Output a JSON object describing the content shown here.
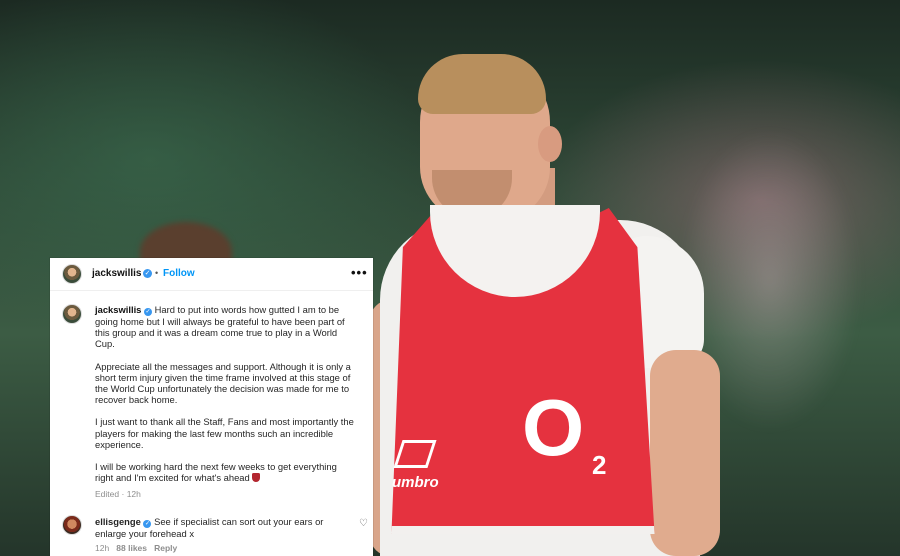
{
  "post": {
    "author": "jackswillis",
    "follow_label": "Follow",
    "separator": "•",
    "more_label": "•••",
    "caption_paragraphs": [
      "Hard to put into words how gutted I am to be going home but I will always be grateful to have been part of this group and it was a dream come true to play in a World Cup.",
      "Appreciate all the messages and support. Although it is only a short term injury given the time frame involved at this stage of the World Cup unfortunately the decision was made for me to recover back home.",
      "I just want to thank all the Staff, Fans and most importantly the players for making the last few months such an incredible experience.",
      "I will be working hard the next few weeks to get everything right and I'm excited for what's ahead"
    ],
    "edited_label": "Edited",
    "edited_dot": "·",
    "edited_time": "12h"
  },
  "comment": {
    "author": "ellisgenge",
    "text": "See if specialist can sort out your ears or enlarge your forehead x",
    "time": "12h",
    "likes": "88 likes",
    "reply_label": "Reply"
  },
  "photo": {
    "bib_logo": "O",
    "bib_logo_sub": "2",
    "bib_brand": "umbro"
  },
  "colors": {
    "verified": "#3897f0",
    "follow": "#0095f6",
    "bib": "#e5323f"
  }
}
